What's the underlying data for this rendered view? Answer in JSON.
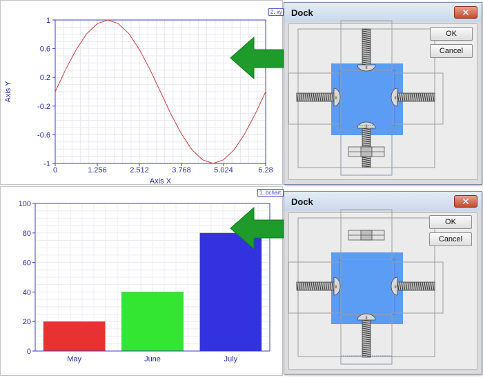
{
  "chart_data": [
    {
      "type": "line",
      "tag": "2. xy",
      "xlabel": "Axis X",
      "ylabel": "Axis Y",
      "xlim": [
        0,
        6.28
      ],
      "ylim": [
        -1,
        1
      ],
      "xticks": [
        "0",
        "1.256",
        "2.512",
        "3.768",
        "5.024",
        "6.28"
      ],
      "yticks": [
        "1",
        "0.6",
        "0.2",
        "-0.2",
        "-0.6",
        "-1"
      ],
      "grid": true,
      "series": [
        {
          "color": "#d03a3a",
          "x": [
            0,
            0.31,
            0.63,
            0.94,
            1.26,
            1.57,
            1.88,
            2.2,
            2.51,
            2.83,
            3.14,
            3.45,
            3.77,
            4.08,
            4.4,
            4.71,
            5.02,
            5.34,
            5.65,
            5.97,
            6.28
          ],
          "y": [
            0,
            0.31,
            0.59,
            0.81,
            0.95,
            1,
            0.95,
            0.81,
            0.59,
            0.31,
            0,
            -0.31,
            -0.59,
            -0.81,
            -0.95,
            -1,
            -0.95,
            -0.81,
            -0.59,
            -0.31,
            0
          ]
        }
      ]
    },
    {
      "type": "bar",
      "tag": "1. bchart",
      "categories": [
        "May",
        "June",
        "July"
      ],
      "values": [
        20,
        40,
        80
      ],
      "colors": [
        "#e83232",
        "#32e632",
        "#3232e0"
      ],
      "ylim": [
        0,
        100
      ],
      "yticks": [
        "0",
        "20",
        "40",
        "60",
        "80",
        "100"
      ],
      "grid": true
    }
  ],
  "arrow_color": "#1e9b2a",
  "dialogs": [
    {
      "title": "Dock",
      "ok_label": "OK",
      "cancel_label": "Cancel",
      "close_glyph": "✕",
      "highlight_color": "#5b9cf5",
      "handle_marks": [
        "II",
        "II",
        "II",
        "II"
      ]
    },
    {
      "title": "Dock",
      "ok_label": "OK",
      "cancel_label": "Cancel",
      "close_glyph": "✕",
      "highlight_color": "#5b9cf5",
      "handle_marks": [
        "II",
        "II",
        "II",
        "II"
      ]
    }
  ]
}
